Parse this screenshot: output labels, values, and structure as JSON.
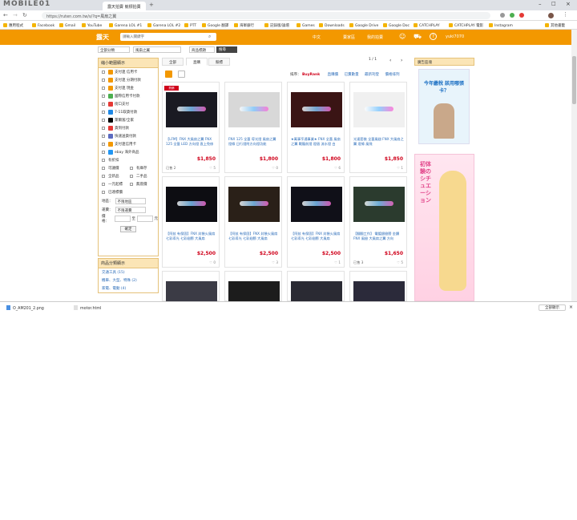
{
  "browser": {
    "tab_title": "露天拍賣 競標拍賣",
    "url": "https://ruten.com.tw/s/?q=風扇之翼",
    "watermark": "MOBILE01",
    "bookmarks": [
      "應用程式",
      "Facebook",
      "Gmail",
      "YouTube",
      "Garena LOL #1",
      "Garena LOL #2",
      "PTT",
      "Google 翻譯",
      "海軍銀行",
      "記錄版/論壇",
      "Games",
      "Downloads",
      "Google Drive",
      "Google Doc",
      "CATCHPLAY",
      "CATCHPLAY 電影",
      "Instagram",
      "其他書籤"
    ]
  },
  "header": {
    "logo": "露天",
    "search_placeholder": "請輸入關鍵字",
    "nav": [
      "中文",
      "賣家區",
      "我的拍賣",
      "yuki7070"
    ]
  },
  "search": {
    "category": "全部分類",
    "keyword": "風扇之翼",
    "scope": "商品標題",
    "button": "搜尋"
  },
  "filter": {
    "title": "縮小範圍顯示",
    "items": [
      "支付連 信用卡",
      "支付連 分期付款",
      "支付連 現金",
      "國際信用卡付款",
      "街口支付",
      "7-11取貨付款",
      "萊爾富/全家",
      "貨到付款",
      "快速送貨付款",
      "支付連信用卡",
      "ebay 海外商品",
      "有折扣"
    ],
    "pairs": [
      [
        "可議價",
        "有庫存"
      ],
      [
        "全新品",
        "二手品"
      ],
      [
        "一元起標",
        "無底價"
      ]
    ],
    "last": "已達標價",
    "location_label": "地區：",
    "location_value": "不限地區",
    "shipping_label": "運費：",
    "shipping_value": "不限運費",
    "price_label": "價格：",
    "price_to": "至",
    "price_unit": "元",
    "ok": "確定"
  },
  "categories": {
    "title": "商品分類顯示",
    "items": [
      "交通工具 (15)",
      "機車、大型、特殊 (2)",
      "家電、電動 (4)"
    ]
  },
  "listing": {
    "tabs": [
      "全部",
      "直購",
      "競標"
    ],
    "page": "1 / 1",
    "sort_label": "排序：",
    "sort_value": "BuyRank",
    "filters": [
      "直購價",
      "已賣數量",
      "最新刊登",
      "價格排列"
    ]
  },
  "products": [
    {
      "title": "【LFM】FNX 大風扇之翼 FNX 125 全蓋 LED 方向燈 直上免修",
      "price": "1,850",
      "sold": "已售 2",
      "fav": "5",
      "tag": "熱銷"
    },
    {
      "title": "FNX 125 全蓋 導光燈 風扇之翼 燈條 日行燈附方向燈功能",
      "price": "1,800",
      "sold": "",
      "fav": "0",
      "tag": ""
    },
    {
      "title": "★萬事亨通事業★ FNX 全蓋 風扇之翼 戰龍前燈 燈眉 流水燈 白",
      "price": "1,800",
      "sold": "",
      "fav": "6",
      "tag": ""
    },
    {
      "title": "光速套裝 全蓋風翅 FNX 大風扇之翼 燈條 風飛",
      "price": "1,850",
      "sold": "",
      "fav": "1",
      "tag": ""
    },
    {
      "title": "【阿茲 有保固】FNX 封裝火風扇 七彩導光 七彩翅膀 大風扇",
      "price": "2,500",
      "sold": "",
      "fav": "0",
      "tag": ""
    },
    {
      "title": "【阿茲 有保固】FNX 封裝火風扇 七彩導光 七彩翅膀 大風扇",
      "price": "2,500",
      "sold": "",
      "fav": "3",
      "tag": ""
    },
    {
      "title": "【阿茲 有保固】FNX 封裝火風扇 七彩導光 七彩翅膀 大風扇",
      "price": "2,500",
      "sold": "",
      "fav": "1",
      "tag": ""
    },
    {
      "title": "【翻翻工作】 電鍍銀翅膀 金鑽 FNX 風翅 大風扇之翼 方向",
      "price": "1,650",
      "sold": "已售 3",
      "fav": "5",
      "tag": ""
    }
  ],
  "ads": {
    "title": "廣告區塊",
    "ad1_text": "今年繳稅 該用哪張卡？",
    "ad2_text": "初体験のシチュエーション"
  },
  "downloads": [
    {
      "name": "O_AM201_2.png"
    },
    {
      "name": "motor.html"
    }
  ],
  "shelf_button": "全部顯示"
}
